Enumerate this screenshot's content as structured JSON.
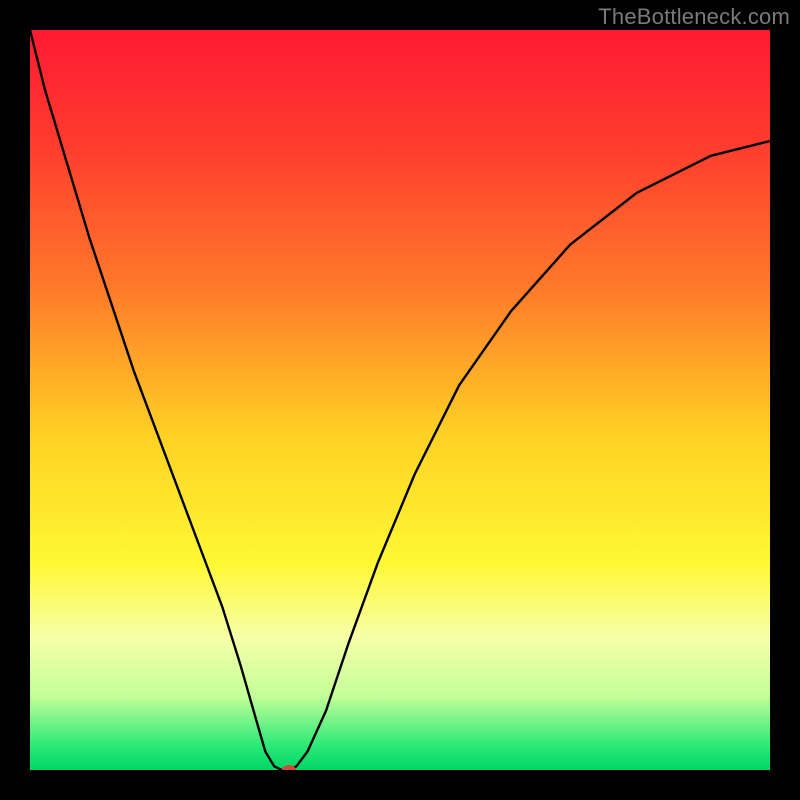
{
  "watermark": "TheBottleneck.com",
  "chart_data": {
    "type": "line",
    "title": "",
    "xlabel": "",
    "ylabel": "",
    "xlim": [
      0,
      100
    ],
    "ylim": [
      0,
      100
    ],
    "gradient_stops": [
      {
        "offset": 0.0,
        "color": "#ff1a33"
      },
      {
        "offset": 0.15,
        "color": "#ff3a2e"
      },
      {
        "offset": 0.35,
        "color": "#ff7a2a"
      },
      {
        "offset": 0.55,
        "color": "#ffd224"
      },
      {
        "offset": 0.72,
        "color": "#fff833"
      },
      {
        "offset": 0.82,
        "color": "#f8ffa8"
      },
      {
        "offset": 0.9,
        "color": "#c4ff99"
      },
      {
        "offset": 0.965,
        "color": "#2fea78"
      },
      {
        "offset": 1.0,
        "color": "#00d765"
      }
    ],
    "curve": {
      "x": [
        0,
        2,
        5,
        8,
        11,
        14,
        17,
        20,
        23,
        26,
        28.5,
        30.5,
        31.8,
        33,
        34,
        35,
        36,
        37.5,
        40,
        43,
        47,
        52,
        58,
        65,
        73,
        82,
        92,
        100
      ],
      "y": [
        100,
        92,
        82,
        72,
        63,
        54,
        46,
        38,
        30,
        22,
        14,
        7,
        2.5,
        0.5,
        0,
        0,
        0.5,
        2.5,
        8,
        17,
        28,
        40,
        52,
        62,
        71,
        78,
        83,
        85
      ]
    },
    "marker": {
      "x": 35,
      "y": 0,
      "color": "#d24a3a",
      "rx": 7,
      "ry": 5
    }
  }
}
